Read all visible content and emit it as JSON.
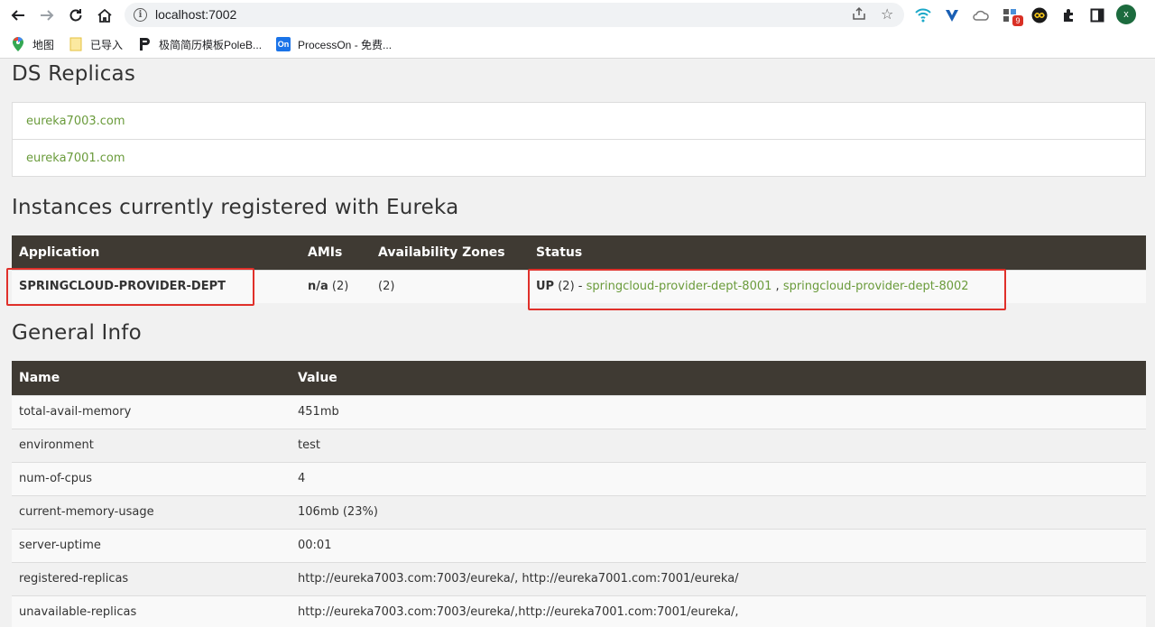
{
  "browser": {
    "url": "localhost:7002",
    "bookmarks": [
      {
        "label": "地图",
        "icon": "maps-pin-icon"
      },
      {
        "label": "已导入",
        "icon": "folder-icon"
      },
      {
        "label": "极简简历模板PoleB...",
        "icon": "poleb-icon"
      },
      {
        "label": "ProcessOn - 免费...",
        "icon": "processon-icon"
      }
    ],
    "processon_icon_text": "On",
    "extension_badge": "9",
    "avatar_letter": "x"
  },
  "replicas": {
    "heading": "DS Replicas",
    "items": [
      "eureka7003.com",
      "eureka7001.com"
    ]
  },
  "instances": {
    "heading": "Instances currently registered with Eureka",
    "columns": [
      "Application",
      "AMIs",
      "Availability Zones",
      "Status"
    ],
    "row": {
      "application": "SPRINGCLOUD-PROVIDER-DEPT",
      "amis_label": "n/a",
      "amis_count": "(2)",
      "zones": "(2)",
      "status_label": "UP",
      "status_count": "(2) -",
      "instance_1": "springcloud-provider-dept-8001",
      "separator": ",",
      "instance_2": "springcloud-provider-dept-8002"
    }
  },
  "general": {
    "heading": "General Info",
    "columns": [
      "Name",
      "Value"
    ],
    "rows": [
      {
        "name": "total-avail-memory",
        "value": "451mb"
      },
      {
        "name": "environment",
        "value": "test"
      },
      {
        "name": "num-of-cpus",
        "value": "4"
      },
      {
        "name": "current-memory-usage",
        "value": "106mb (23%)"
      },
      {
        "name": "server-uptime",
        "value": "00:01"
      },
      {
        "name": "registered-replicas",
        "value": "http://eureka7003.com:7003/eureka/, http://eureka7001.com:7001/eureka/"
      },
      {
        "name": "unavailable-replicas",
        "value": "http://eureka7003.com:7003/eureka/,http://eureka7001.com:7001/eureka/,"
      }
    ]
  },
  "colors": {
    "header_bg": "#3f3a33",
    "link": "#6a9b3b",
    "highlight_box": "#e0302a"
  }
}
